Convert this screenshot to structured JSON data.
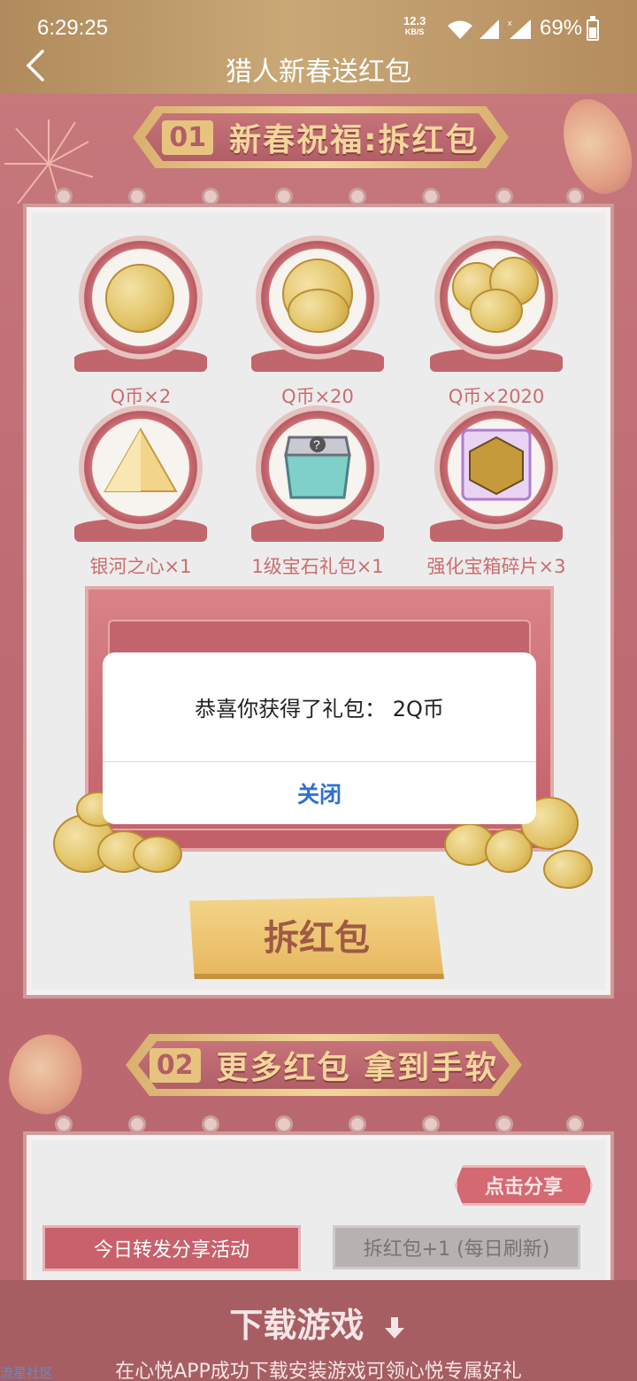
{
  "status_bar": {
    "time": "6:29:25",
    "net_speed_value": "12.3",
    "net_speed_unit": "KB/S",
    "battery": "69%",
    "icons": [
      "wifi-icon",
      "signal-icon",
      "signal-x-icon",
      "battery-icon"
    ]
  },
  "header": {
    "title": "猎人新春送红包"
  },
  "section1": {
    "number": "01",
    "title": "新春祝福:拆红包",
    "prizes": [
      {
        "label": "Q币×2"
      },
      {
        "label": "Q币×20"
      },
      {
        "label": "Q币×2020"
      },
      {
        "label": "银河之心×1"
      },
      {
        "label": "1级宝石礼包×1"
      },
      {
        "label": "强化宝箱碎片×3"
      }
    ],
    "open_button": "拆红包"
  },
  "section2": {
    "number": "02",
    "title": "更多红包 拿到手软",
    "share_button": "点击分享",
    "task_label": "今日转发分享活动",
    "task_reward": "拆红包+1 (每日刷新)"
  },
  "download": {
    "title": "下载游戏",
    "subtitle": "在心悦APP成功下载安装游戏可领心悦专属好礼"
  },
  "watermark": "流星社区",
  "dialog": {
    "message": "恭喜你获得了礼包： 2Q币",
    "close_button": "关闭"
  },
  "colors": {
    "header": "#c4a06c",
    "page_bg": "#c2707a",
    "dialog_button": "#2f6fd1"
  }
}
